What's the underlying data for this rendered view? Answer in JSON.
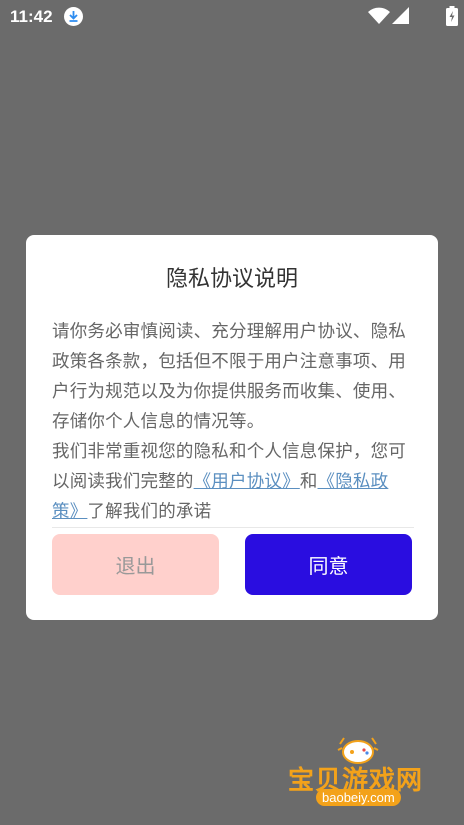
{
  "status_bar": {
    "time": "11:42",
    "icons": [
      "download-icon",
      "wifi-icon",
      "signal-icon",
      "battery-icon"
    ]
  },
  "dialog": {
    "title": "隐私协议说明",
    "paragraph1": "请你务必审慎阅读、充分理解用户协议、隐私政策各条款，包括但不限于用户注意事项、用户行为规范以及为你提供服务而收集、使用、存储你个人信息的情况等。",
    "paragraph2_prefix": "我们非常重视您的隐私和个人信息保护，您可以阅读我们完整的",
    "user_agreement_link": "《用户协议》",
    "and": "和",
    "privacy_policy_link": "《隐私政策》",
    "paragraph2_suffix": "了解我们的承诺",
    "exit_button": "退出",
    "agree_button": "同意"
  },
  "watermark": {
    "title": "宝贝游戏网",
    "url": "baobeiy.com"
  },
  "colors": {
    "overlay": "#6b6b6b",
    "agree_button": "#2a0de0",
    "exit_button": "#ffd0cc",
    "link": "#5b8fc0",
    "watermark": "#f3a21a"
  }
}
